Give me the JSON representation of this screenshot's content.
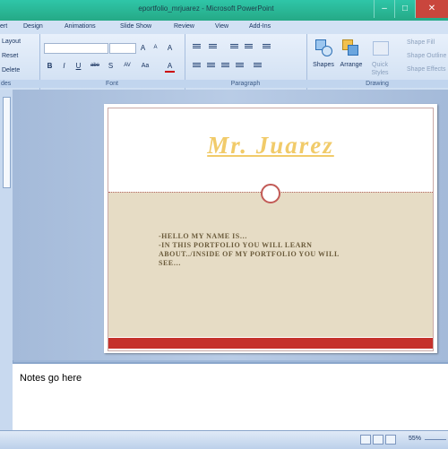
{
  "window": {
    "title": "eportfolio_mrjuarez - Microsoft PowerPoint",
    "controls": [
      "–",
      "□",
      "✕"
    ]
  },
  "tabs": [
    "ert",
    "Design",
    "Animations",
    "Slide Show",
    "Review",
    "View",
    "Add-Ins"
  ],
  "ribbon": {
    "slides": {
      "layout": "Layout",
      "reset": "Reset",
      "delete": "Delete",
      "group": "des"
    },
    "font": {
      "group": "Font",
      "bold": "B",
      "italic": "I",
      "underline": "U",
      "strike": "abe",
      "shadow": "S",
      "grow": "A",
      "shrink": "A",
      "clear": "A",
      "spacing": "AV",
      "case": "Aa",
      "color": "A"
    },
    "paragraph": {
      "group": "Paragraph"
    },
    "drawing": {
      "group": "Drawing",
      "shapes": "Shapes",
      "arrange": "Arrange",
      "quick_styles_1": "Quick",
      "quick_styles_2": "Styles",
      "fill": "Shape Fill",
      "outline": "Shape Outline",
      "effects": "Shape Effects"
    }
  },
  "slide": {
    "title": "Mr. Juarez",
    "bullets": [
      "-HELLO MY NAME IS…",
      "-IN THIS PORTFOLIO YOU WILL LEARN",
      "ABOUT../INSIDE OF MY PORTFOLIO YOU WILL",
      "SEE…"
    ]
  },
  "notes": {
    "placeholder": "Notes go here"
  },
  "status": {
    "zoom": "55%"
  },
  "colors": {
    "title": "#f1cb6a",
    "accent_red": "#c5312b",
    "panel": "#e6dcc5",
    "titlebar": "#2fc6a8"
  }
}
